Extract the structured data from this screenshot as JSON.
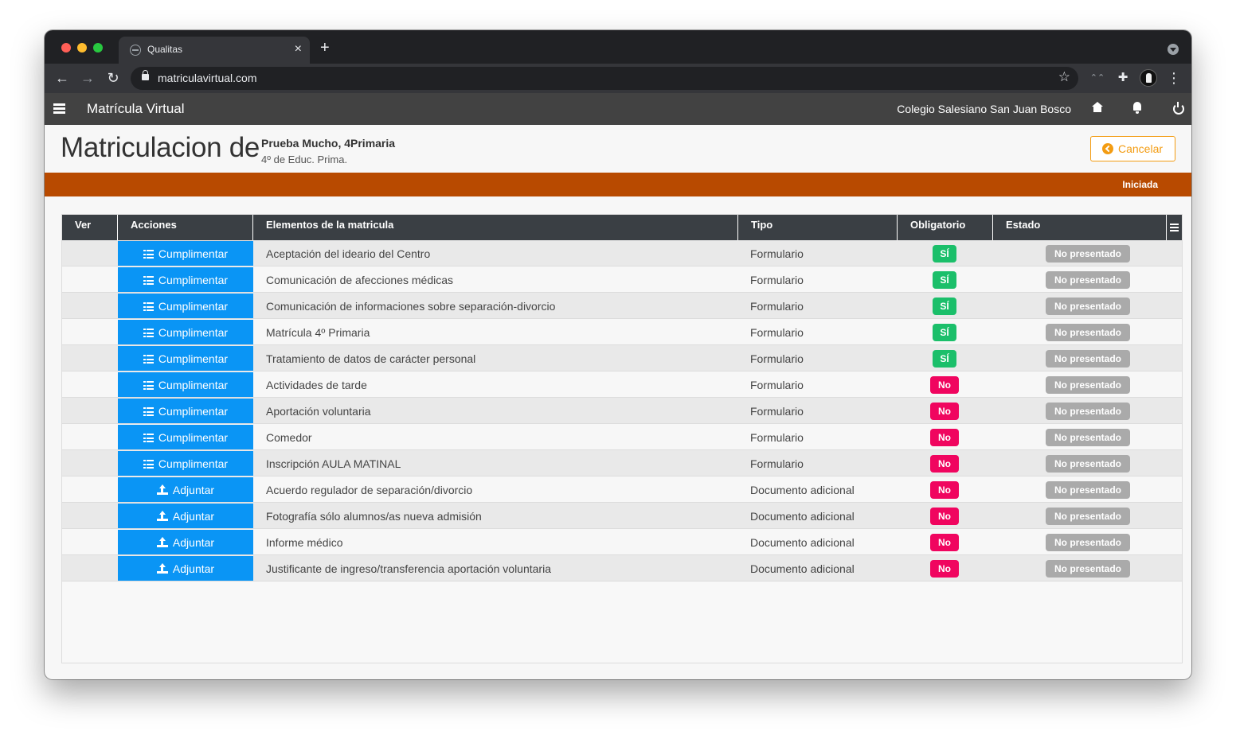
{
  "browser": {
    "tab_title": "Qualitas",
    "tab_close": "×",
    "new_tab": "+",
    "url": "matriculavirtual.com",
    "back": "←",
    "forward": "→",
    "reload": "↻",
    "bookmark": "☆",
    "menu": "⋮",
    "extensions_icon": "✚"
  },
  "app": {
    "title": "Matrícula Virtual",
    "school": "Colegio Salesiano San Juan Bosco"
  },
  "page": {
    "title": "Matriculacion de",
    "student_name": "Prueba Mucho, 4Primaria",
    "student_course": "4º de Educ. Prima.",
    "cancel_label": "Cancelar",
    "status": "Iniciada",
    "status_color": "#b84a00"
  },
  "table": {
    "headers": [
      "Ver",
      "Acciones",
      "Elementos de la matricula",
      "Tipo",
      "Obligatorio",
      "Estado"
    ],
    "rows": [
      {
        "action": "Cumplimentar",
        "element": "Aceptación del ideario del Centro",
        "tipo": "Formulario",
        "obligatorio": "SÍ",
        "estado": "No presentado"
      },
      {
        "action": "Cumplimentar",
        "element": "Comunicación de afecciones médicas",
        "tipo": "Formulario",
        "obligatorio": "SÍ",
        "estado": "No presentado"
      },
      {
        "action": "Cumplimentar",
        "element": "Comunicación de informaciones sobre separación-divorcio",
        "tipo": "Formulario",
        "obligatorio": "SÍ",
        "estado": "No presentado"
      },
      {
        "action": "Cumplimentar",
        "element": "Matrícula 4º Primaria",
        "tipo": "Formulario",
        "obligatorio": "SÍ",
        "estado": "No presentado"
      },
      {
        "action": "Cumplimentar",
        "element": "Tratamiento de datos de carácter personal",
        "tipo": "Formulario",
        "obligatorio": "SÍ",
        "estado": "No presentado"
      },
      {
        "action": "Cumplimentar",
        "element": "Actividades de tarde",
        "tipo": "Formulario",
        "obligatorio": "No",
        "estado": "No presentado"
      },
      {
        "action": "Cumplimentar",
        "element": "Aportación voluntaria",
        "tipo": "Formulario",
        "obligatorio": "No",
        "estado": "No presentado"
      },
      {
        "action": "Cumplimentar",
        "element": "Comedor",
        "tipo": "Formulario",
        "obligatorio": "No",
        "estado": "No presentado"
      },
      {
        "action": "Cumplimentar",
        "element": "Inscripción AULA MATINAL",
        "tipo": "Formulario",
        "obligatorio": "No",
        "estado": "No presentado"
      },
      {
        "action": "Adjuntar",
        "element": "Acuerdo regulador de separación/divorcio",
        "tipo": "Documento adicional",
        "obligatorio": "No",
        "estado": "No presentado"
      },
      {
        "action": "Adjuntar",
        "element": "Fotografía sólo alumnos/as nueva admisión",
        "tipo": "Documento adicional",
        "obligatorio": "No",
        "estado": "No presentado"
      },
      {
        "action": "Adjuntar",
        "element": "Informe médico",
        "tipo": "Documento adicional",
        "obligatorio": "No",
        "estado": "No presentado"
      },
      {
        "action": "Adjuntar",
        "element": "Justificante de ingreso/transferencia aportación voluntaria",
        "tipo": "Documento adicional",
        "obligatorio": "No",
        "estado": "No presentado"
      }
    ]
  },
  "colors": {
    "action_button": "#0a95f5",
    "badge_si": "#1bbf6a",
    "badge_no": "#f0055f",
    "badge_estado": "#aaaaaa",
    "header_bg": "#424242",
    "table_header_bg": "#3a3f44",
    "cancel": "#f39c12"
  }
}
